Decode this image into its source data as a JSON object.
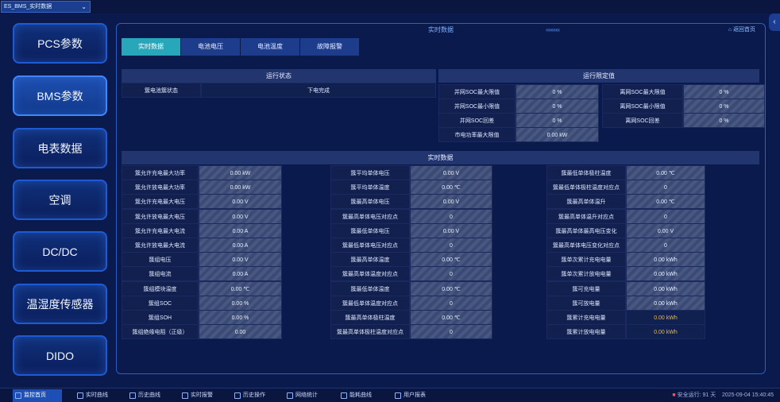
{
  "window": {
    "title": "ES_BMS_实时数据"
  },
  "nav": [
    {
      "label": "PCS参数"
    },
    {
      "label": "BMS参数"
    },
    {
      "label": "电表数据"
    },
    {
      "label": "空调"
    },
    {
      "label": "DC/DC"
    },
    {
      "label": "温湿度传感器"
    },
    {
      "label": "DIDO"
    }
  ],
  "panel": {
    "title": "实时数据",
    "home": "返回首页"
  },
  "tabs": [
    "实时数据",
    "电池电压",
    "电池温度",
    "故障报警"
  ],
  "run_state": {
    "header": "运行状态",
    "label": "簇电池簇状态",
    "value": "下电完成"
  },
  "limits": {
    "header": "运行限定值",
    "left": [
      {
        "label": "并网SOC最大限值",
        "value": "0 %"
      },
      {
        "label": "并网SOC最小限值",
        "value": "0 %"
      },
      {
        "label": "并网SOC回差",
        "value": "0 %"
      },
      {
        "label": "市电功率最大限值",
        "value": "0.00 kW"
      }
    ],
    "right": [
      {
        "label": "离网SOC最大限值",
        "value": "0 %"
      },
      {
        "label": "离网SOC最小限值",
        "value": "0 %"
      },
      {
        "label": "离网SOC回差",
        "value": "0 %"
      }
    ]
  },
  "realtime": {
    "header": "实时数据",
    "col1": [
      {
        "label": "簇允许充电最大功率",
        "value": "0.00 kW"
      },
      {
        "label": "簇允许放电最大功率",
        "value": "0.00 kW"
      },
      {
        "label": "簇允许充电最大电压",
        "value": "0.00 V"
      },
      {
        "label": "簇允许放电最大电压",
        "value": "0.00 V"
      },
      {
        "label": "簇允许充电最大电流",
        "value": "0.00 A"
      },
      {
        "label": "簇允许放电最大电流",
        "value": "0.00 A"
      },
      {
        "label": "簇组电压",
        "value": "0.00 V"
      },
      {
        "label": "簇组电流",
        "value": "0.00 A"
      },
      {
        "label": "簇组模块温度",
        "value": "0.00 ℃"
      },
      {
        "label": "簇组SOC",
        "value": "0.00 %"
      },
      {
        "label": "簇组SOH",
        "value": "0.00 %"
      },
      {
        "label": "簇组绝缘电阻（正级）",
        "value": "0.00"
      }
    ],
    "col2": [
      {
        "label": "簇平均单体电压",
        "value": "0.00 V"
      },
      {
        "label": "簇平均单体温度",
        "value": "0.00 ℃"
      },
      {
        "label": "簇最高单体电压",
        "value": "0.00 V"
      },
      {
        "label": "簇最高单体电压对应点",
        "value": "0"
      },
      {
        "label": "簇最低单体电压",
        "value": "0.00 V"
      },
      {
        "label": "簇最低单体电压对应点",
        "value": "0"
      },
      {
        "label": "簇最高单体温度",
        "value": "0.00 ℃"
      },
      {
        "label": "簇最高单体温度对应点",
        "value": "0"
      },
      {
        "label": "簇最低单体温度",
        "value": "0.00 ℃"
      },
      {
        "label": "簇最低单体温度对应点",
        "value": "0"
      },
      {
        "label": "簇最高单体极柱温度",
        "value": "0.00 ℃"
      },
      {
        "label": "簇最高单体极柱温度对应点",
        "value": "0"
      }
    ],
    "col3": [
      {
        "label": "簇最低单体极柱温度",
        "value": "0.00 ℃",
        "style": "value"
      },
      {
        "label": "簇最低单体极柱温度对应点",
        "value": "0",
        "style": "value"
      },
      {
        "label": "簇最高单体温升",
        "value": "0.00 ℃",
        "style": "value"
      },
      {
        "label": "簇最高单体温升对应点",
        "value": "0",
        "style": "value"
      },
      {
        "label": "簇最高单体最高电压变化",
        "value": "0.00 V",
        "style": "value"
      },
      {
        "label": "簇最高单体电压变化对应点",
        "value": "0",
        "style": "value"
      },
      {
        "label": "簇单次累计充电电量",
        "value": "0.00 kWh",
        "style": "value"
      },
      {
        "label": "簇单次累计放电电量",
        "value": "0.00 kWh",
        "style": "value"
      },
      {
        "label": "簇可充电量",
        "value": "0.00 kWh",
        "style": "value"
      },
      {
        "label": "簇可放电量",
        "value": "0.00 kWh",
        "style": "value"
      },
      {
        "label": "簇累计充电电量",
        "value": "0.00 kWh",
        "style": "yellow"
      },
      {
        "label": "簇累计放电电量",
        "value": "0.00 kWh",
        "style": "yellow"
      }
    ]
  },
  "bottom_nav": [
    {
      "label": "监控首页",
      "active": true
    },
    {
      "label": "实时曲线"
    },
    {
      "label": "历史曲线"
    },
    {
      "label": "实时报警"
    },
    {
      "label": "历史操作"
    },
    {
      "label": "网络统计"
    },
    {
      "label": "能耗曲线"
    },
    {
      "label": "用户报表"
    }
  ],
  "status": {
    "alarm": "安全运行: 91 天",
    "datetime": "2025-09-04 15:40:45"
  }
}
